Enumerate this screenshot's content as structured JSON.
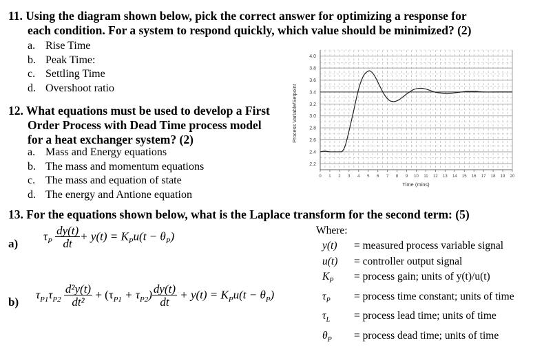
{
  "q11": {
    "line1": "11. Using the diagram shown below, pick the correct answer for optimizing a response for",
    "line2": "each condition. For a system to respond quickly, which value should be minimized? (2)",
    "options": [
      {
        "letter": "a.",
        "text": "Rise Time"
      },
      {
        "letter": "b.",
        "text": "Peak Time:"
      },
      {
        "letter": "c.",
        "text": "Settling Time"
      },
      {
        "letter": "d.",
        "text": "Overshoot ratio"
      }
    ]
  },
  "q12": {
    "line1": "12. What equations must be used to develop a First",
    "line2": "Order Process with Dead Time process model",
    "line3": "for a heat exchanger system? (2)",
    "options": [
      {
        "letter": "a.",
        "text": "Mass and Energy equations"
      },
      {
        "letter": "b.",
        "text": "The mass and momentum equations"
      },
      {
        "letter": "c.",
        "text": "The mass and equation of state"
      },
      {
        "letter": "d.",
        "text": "The energy and Antione equation"
      }
    ]
  },
  "q13": {
    "line1": "13. For the equations shown below, what is the Laplace transform for the second term: (5)",
    "eq_a_label": "a)",
    "eq_b_label": "b)",
    "eq_a": {
      "tau": "τ",
      "tau_sub": "P",
      "num": "dy(t)",
      "den": "dt",
      "rest": "+ y(t) = K",
      "k_sub": "P",
      "tail": "u(t − θ",
      "theta_sub": "P",
      "close": ")"
    },
    "eq_b": {
      "t1": "τ",
      "t1_sub": "P1",
      "t2": "τ",
      "t2_sub": "P2",
      "num1": "d²y(t)",
      "den1": "dt²",
      "mid": "+ (τ",
      "mid_sub1": "P1",
      "mid2": " + τ",
      "mid_sub2": "P2",
      "mid3": ")",
      "num2": "dy(t)",
      "den2": "dt",
      "rest": "+ y(t) = K",
      "k_sub": "P",
      "tail": "u(t − θ",
      "theta_sub": "P",
      "close": ")"
    },
    "where_label": "Where:",
    "definitions": [
      {
        "symbol": "y(t)",
        "text": "= measured process variable signal"
      },
      {
        "symbol": "u(t)",
        "text": "= controller output signal"
      },
      {
        "symbol": "K_P",
        "sym_main": "K",
        "sym_sub": "P",
        "text": "= process gain; units of  y(t)/u(t)"
      },
      {
        "symbol": "τ_P",
        "sym_main": "τ",
        "sym_sub": "P",
        "text": "= process time constant; units of time"
      },
      {
        "symbol": "τ_L",
        "sym_main": "τ",
        "sym_sub": "L",
        "text": "= process lead time; units of time"
      },
      {
        "symbol": "θ_P",
        "sym_main": "θ",
        "sym_sub": "P",
        "text": "= process dead time; units of time"
      }
    ]
  },
  "chart_data": {
    "type": "line",
    "title": "",
    "xlabel": "Time (mins)",
    "ylabel": "Process Variable/Setpoint",
    "xlim": [
      0,
      20
    ],
    "ylim": [
      2.1,
      4.1
    ],
    "xticks": [
      0,
      1,
      2,
      3,
      4,
      5,
      6,
      7,
      8,
      9,
      10,
      11,
      12,
      13,
      14,
      15,
      16,
      17,
      18,
      19,
      20
    ],
    "yticks": [
      2.2,
      2.4,
      2.6,
      2.8,
      3.0,
      3.2,
      3.4,
      3.6,
      3.8,
      4.0
    ],
    "ytick_labels": [
      "2.2",
      "2.4",
      "2.6",
      "2.8",
      "3.0",
      "3.2",
      "3.4",
      "3.6",
      "3.8",
      "4.0"
    ],
    "grid": true,
    "setpoint": 3.4,
    "series": [
      {
        "name": "Process Variable",
        "x": [
          0,
          0.5,
          1,
          1.5,
          2,
          2.3,
          2.6,
          3,
          3.5,
          4,
          4.5,
          5,
          5.3,
          5.7,
          6.2,
          6.7,
          7.2,
          7.7,
          8.2,
          8.7,
          9.2,
          9.7,
          10.2,
          10.7,
          11.2,
          11.7,
          12.2,
          12.7,
          13.2,
          13.7,
          14.2,
          14.7,
          15.2,
          15.7,
          16.2,
          17,
          18,
          19,
          20
        ],
        "y": [
          2.4,
          2.41,
          2.4,
          2.4,
          2.4,
          2.41,
          2.5,
          2.75,
          3.1,
          3.45,
          3.67,
          3.75,
          3.74,
          3.66,
          3.5,
          3.35,
          3.26,
          3.24,
          3.27,
          3.33,
          3.39,
          3.44,
          3.46,
          3.46,
          3.44,
          3.41,
          3.39,
          3.38,
          3.37,
          3.38,
          3.39,
          3.4,
          3.41,
          3.41,
          3.41,
          3.4,
          3.4,
          3.4,
          3.4
        ]
      }
    ]
  }
}
